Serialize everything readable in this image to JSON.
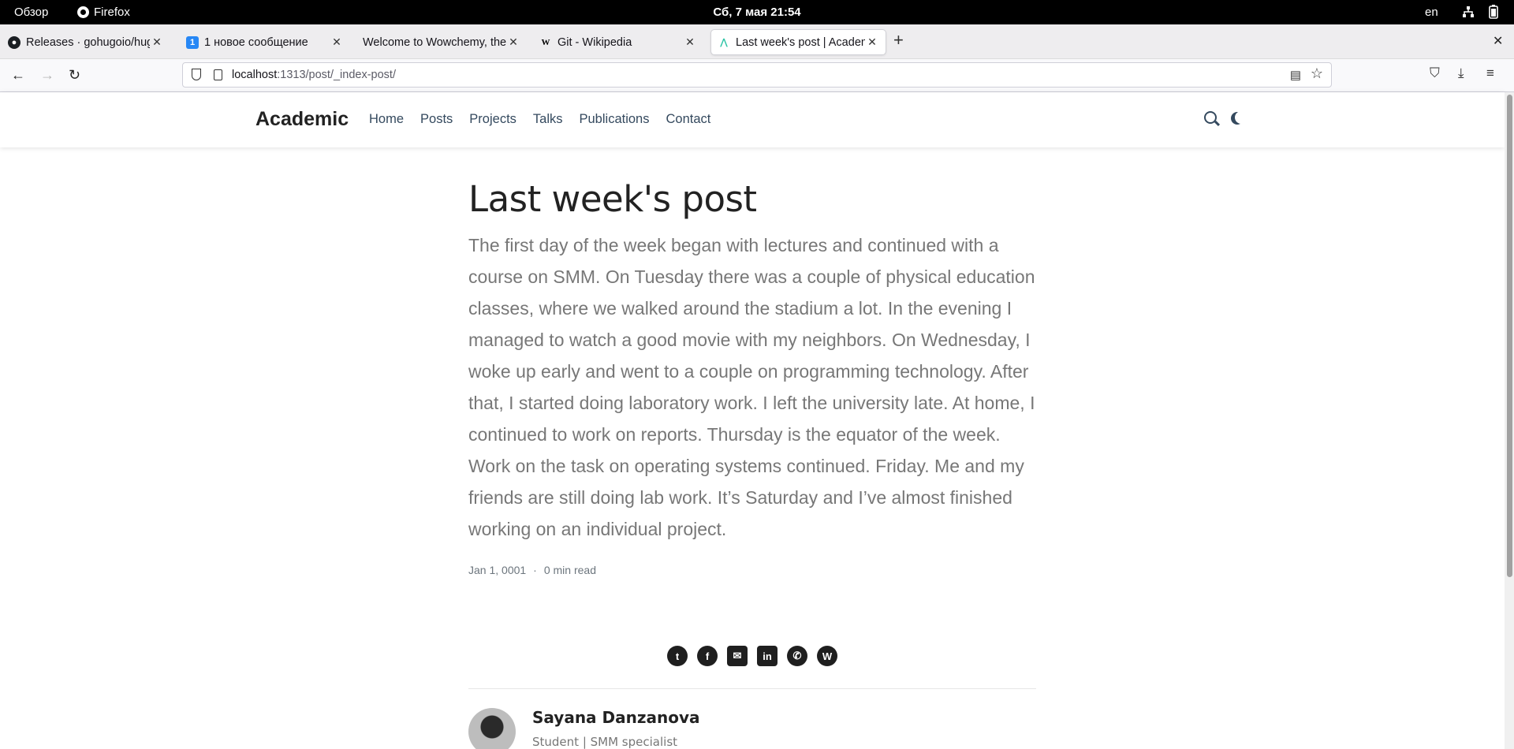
{
  "system_bar": {
    "overview": "Обзор",
    "app_name": "Firefox",
    "clock": "Сб, 7 мая  21:54",
    "language": "en",
    "network_icon": "network-icon",
    "battery_icon": "battery-icon"
  },
  "browser": {
    "tabs": [
      {
        "title": "Releases · gohugoio/hugo",
        "favicon": "github-icon",
        "active": false
      },
      {
        "title": "1 новое сообщение",
        "favicon": "vk-icon",
        "favicon_text": "1",
        "active": false
      },
      {
        "title": "Welcome to Wowchemy, the",
        "favicon": "none",
        "active": false
      },
      {
        "title": "Git - Wikipedia",
        "favicon": "wikipedia-icon",
        "favicon_text": "W",
        "active": false
      },
      {
        "title": "Last week's post | Academ",
        "favicon": "academic-icon",
        "active": true
      }
    ],
    "url_host": "localhost",
    "url_rest": ":1313/post/_index-post/"
  },
  "site": {
    "brand": "Academic",
    "nav": [
      "Home",
      "Posts",
      "Projects",
      "Talks",
      "Publications",
      "Contact"
    ]
  },
  "post": {
    "title": "Last week's post",
    "summary": "The first day of the week began with lectures and continued with a course on SMM. On Tuesday there was a couple of physical education classes, where we walked around the stadium a lot. In the evening I managed to watch a good movie with my neighbors. On Wednesday, I woke up early and went to a couple on programming technology. After that, I started doing laboratory work. I left the university late. At home, I continued to work on reports. Thursday is the equator of the week. Work on the task on operating systems continued. Friday. Me and my friends are still doing lab work. It’s Saturday and I’ve almost finished working on an individual project.",
    "date": "Jan 1, 0001",
    "separator": "·",
    "read_time": "0 min read"
  },
  "share": [
    {
      "name": "twitter-icon",
      "glyph": "t"
    },
    {
      "name": "facebook-icon",
      "glyph": "f"
    },
    {
      "name": "email-icon",
      "glyph": "✉"
    },
    {
      "name": "linkedin-icon",
      "glyph": "in"
    },
    {
      "name": "whatsapp-icon",
      "glyph": "✆"
    },
    {
      "name": "weibo-icon",
      "glyph": "W"
    }
  ],
  "author": {
    "name": "Sayana Danzanova",
    "role": "Student | SMM specialist"
  }
}
